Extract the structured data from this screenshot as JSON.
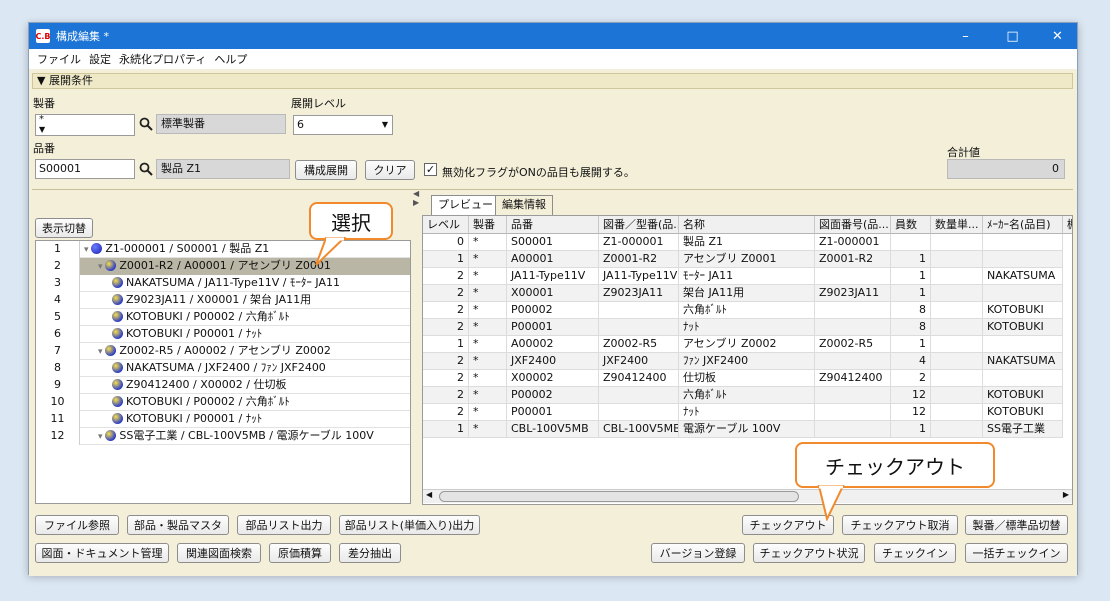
{
  "window": {
    "title": "構成編集 *",
    "icon_text": "C.B"
  },
  "menu": [
    "ファイル",
    "設定",
    "永続化プロパティ",
    "ヘルプ"
  ],
  "conditions": {
    "header": "▼ 展開条件",
    "seiban_label": "製番",
    "seiban_value": "*",
    "seiban_name": "標準製番",
    "level_label": "展開レベル",
    "level_value": "6",
    "hinban_label": "品番",
    "hinban_value": "S00001",
    "hinban_name": "製品 Z1",
    "expand_button": "構成展開",
    "clear_button": "クリア",
    "checkbox_label": "無効化フラグがONの品目も展開する。",
    "checkbox_checked": true,
    "total_label": "合計値",
    "total_value": "0"
  },
  "tree": {
    "toggle_button": "表示切替",
    "rows": [
      {
        "num": "1",
        "text": "Z1-000001 / S00001 / 製品 Z1"
      },
      {
        "num": "2",
        "text": "Z0001-R2 / A00001 / アセンブリ Z0001"
      },
      {
        "num": "3",
        "text": "NAKATSUMA / JA11-Type11V / ﾓｰﾀｰ JA11"
      },
      {
        "num": "4",
        "text": "Z9023JA11 / X00001 / 架台 JA11用"
      },
      {
        "num": "5",
        "text": "KOTOBUKI / P00002 / 六角ﾎﾞﾙﾄ"
      },
      {
        "num": "6",
        "text": "KOTOBUKI / P00001 / ﾅｯﾄ"
      },
      {
        "num": "7",
        "text": "Z0002-R5 / A00002 / アセンブリ Z0002"
      },
      {
        "num": "8",
        "text": "NAKATSUMA / JXF2400 / ﾌｧﾝ JXF2400"
      },
      {
        "num": "9",
        "text": "Z90412400 / X00002 / 仕切板"
      },
      {
        "num": "10",
        "text": "KOTOBUKI / P00002 / 六角ﾎﾞﾙﾄ"
      },
      {
        "num": "11",
        "text": "KOTOBUKI / P00001 / ﾅｯﾄ"
      },
      {
        "num": "12",
        "text": "SS電子工業 / CBL-100V5MB / 電源ケーブル 100V"
      }
    ]
  },
  "tabs": [
    "プレビュー",
    "編集情報"
  ],
  "grid": {
    "headers": [
      "レベル",
      "製番",
      "品番",
      "図番／型番(品...",
      "名称",
      "図面番号(品...",
      "員数",
      "数量単...",
      "ﾒｰｶｰ名(品目)",
      "棚"
    ],
    "rows": [
      [
        "0",
        "*",
        "S00001",
        "Z1-000001",
        "製品 Z1",
        "Z1-000001",
        "",
        "",
        ""
      ],
      [
        "1",
        "*",
        "A00001",
        "Z0001-R2",
        "アセンブリ Z0001",
        "Z0001-R2",
        "1",
        "",
        ""
      ],
      [
        "2",
        "*",
        "JA11-Type11V",
        "JA11-Type11V",
        "ﾓｰﾀｰ JA11",
        "",
        "1",
        "",
        "NAKATSUMA"
      ],
      [
        "2",
        "*",
        "X00001",
        "Z9023JA11",
        "架台 JA11用",
        "Z9023JA11",
        "1",
        "",
        ""
      ],
      [
        "2",
        "*",
        "P00002",
        "",
        "六角ﾎﾞﾙﾄ",
        "",
        "8",
        "",
        "KOTOBUKI"
      ],
      [
        "2",
        "*",
        "P00001",
        "",
        "ﾅｯﾄ",
        "",
        "8",
        "",
        "KOTOBUKI"
      ],
      [
        "1",
        "*",
        "A00002",
        "Z0002-R5",
        "アセンブリ Z0002",
        "Z0002-R5",
        "1",
        "",
        ""
      ],
      [
        "2",
        "*",
        "JXF2400",
        "JXF2400",
        "ﾌｧﾝ JXF2400",
        "",
        "4",
        "",
        "NAKATSUMA"
      ],
      [
        "2",
        "*",
        "X00002",
        "Z90412400",
        "仕切板",
        "Z90412400",
        "2",
        "",
        ""
      ],
      [
        "2",
        "*",
        "P00002",
        "",
        "六角ﾎﾞﾙﾄ",
        "",
        "12",
        "",
        "KOTOBUKI"
      ],
      [
        "2",
        "*",
        "P00001",
        "",
        "ﾅｯﾄ",
        "",
        "12",
        "",
        "KOTOBUKI"
      ],
      [
        "1",
        "*",
        "CBL-100V5MB",
        "CBL-100V5MB",
        "電源ケーブル 100V",
        "",
        "1",
        "",
        "SS電子工業"
      ]
    ]
  },
  "buttons": {
    "file_ref": "ファイル参照",
    "parts_master": "部品・製品マスタ",
    "parts_list_out": "部品リスト出力",
    "parts_list_price": "部品リスト(単価入り)出力",
    "drawing_mgmt": "図面・ドキュメント管理",
    "related_search": "関連図面検索",
    "cost_calc": "原価積算",
    "diff_extract": "差分抽出",
    "checkout": "チェックアウト",
    "checkout_cancel": "チェックアウト取消",
    "seiban_switch": "製番／標準品切替",
    "version_reg": "バージョン登録",
    "checkout_status": "チェックアウト状況",
    "checkin": "チェックイン",
    "bulk_checkin": "一括チェックイン"
  },
  "callouts": {
    "select": "選択",
    "checkout": "チェックアウト"
  },
  "colors": {
    "titlebar": "#1b74d6",
    "callout_border": "#f08a2c",
    "panel_bg": "#f3efd9",
    "selected_row": "#b9b6a5"
  }
}
